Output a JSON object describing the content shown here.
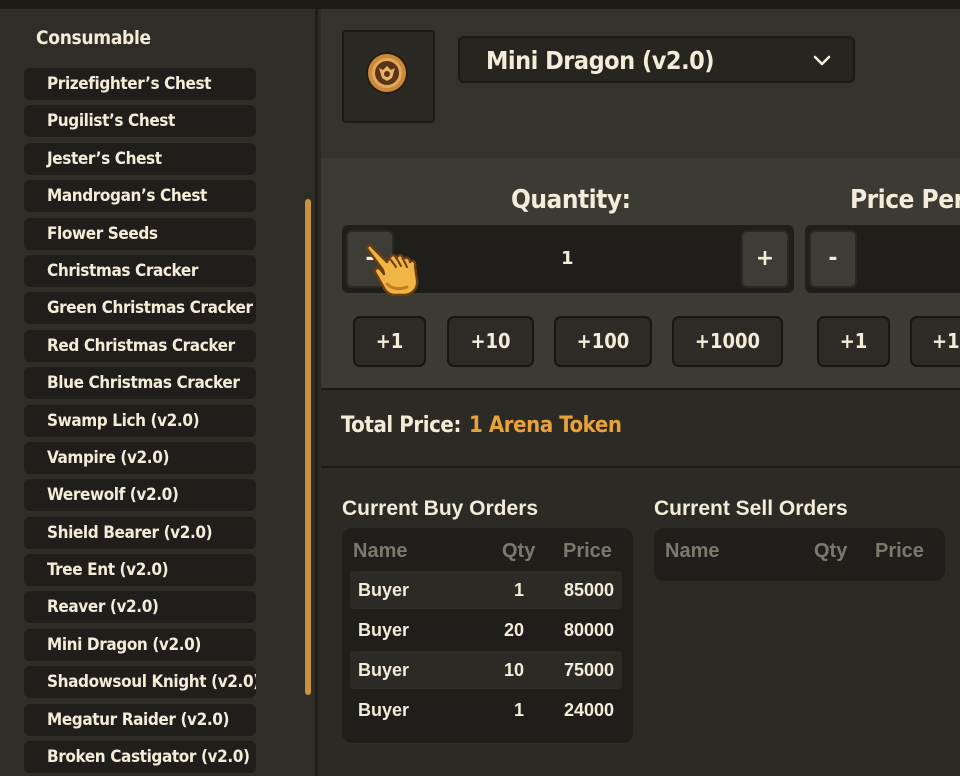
{
  "sidebar": {
    "title": "Consumable",
    "items": [
      "Prizefighter’s Chest",
      "Pugilist’s Chest",
      "Jester’s Chest",
      "Mandrogan’s Chest",
      "Flower Seeds",
      "Christmas Cracker",
      "Green Christmas Cracker",
      "Red Christmas Cracker",
      "Blue Christmas Cracker",
      "Swamp Lich (v2.0)",
      "Vampire (v2.0)",
      "Werewolf (v2.0)",
      "Shield Bearer (v2.0)",
      "Tree Ent (v2.0)",
      "Reaver (v2.0)",
      "Mini Dragon (v2.0)",
      "Shadowsoul Knight (v2.0)",
      "Megatur Raider (v2.0)",
      "Broken Castigator (v2.0)"
    ]
  },
  "item_select": {
    "selected": "Mini Dragon (v2.0)",
    "icon": "arena-token-icon"
  },
  "quantity": {
    "title": "Quantity:",
    "minus": "-",
    "plus": "+",
    "value": "1",
    "increments": [
      "+1",
      "+10",
      "+100",
      "+1000"
    ]
  },
  "price_per": {
    "title": "Price Per",
    "minus": "-",
    "increments": [
      "+1",
      "+1"
    ]
  },
  "total": {
    "label": "Total Price:",
    "value": "1 Arena Token"
  },
  "buy_orders": {
    "title": "Current Buy Orders",
    "headers": {
      "name": "Name",
      "qty": "Qty",
      "price": "Price"
    },
    "rows": [
      {
        "name": "Buyer",
        "qty": "1",
        "price": "85000"
      },
      {
        "name": "Buyer",
        "qty": "20",
        "price": "80000"
      },
      {
        "name": "Buyer",
        "qty": "10",
        "price": "75000"
      },
      {
        "name": "Buyer",
        "qty": "1",
        "price": "24000"
      }
    ]
  },
  "sell_orders": {
    "title": "Current Sell Orders",
    "headers": {
      "name": "Name",
      "qty": "Qty",
      "price": "Price"
    },
    "rows": []
  },
  "colors": {
    "accent": "#e9a23b",
    "scrollbar": "#c9933e",
    "panel": "#1f1e1a"
  }
}
